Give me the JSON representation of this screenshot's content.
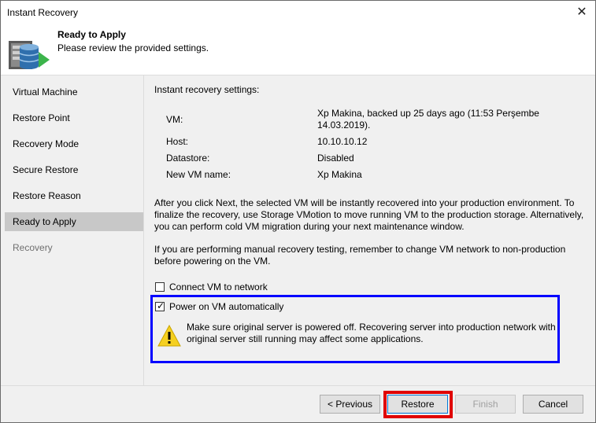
{
  "window": {
    "title": "Instant Recovery"
  },
  "header": {
    "title": "Ready to Apply",
    "subtitle": "Please review the provided  settings."
  },
  "sidebar": {
    "items": [
      {
        "label": "Virtual Machine"
      },
      {
        "label": "Restore Point"
      },
      {
        "label": "Recovery Mode"
      },
      {
        "label": "Secure Restore"
      },
      {
        "label": "Restore Reason"
      },
      {
        "label": "Ready to Apply"
      },
      {
        "label": "Recovery"
      }
    ]
  },
  "main": {
    "section_title": "Instant recovery settings:",
    "settings": [
      {
        "key": "VM:",
        "value_line1": "Xp Makina, backed up 25 days ago (11:53 Perşembe",
        "value_line2": "14.03.2019)."
      },
      {
        "key": "Host:",
        "value_line1": "10.10.10.12"
      },
      {
        "key": "Datastore:",
        "value_line1": "Disabled"
      },
      {
        "key": "New VM name:",
        "value_line1": "Xp Makina"
      }
    ],
    "info1": "After you click Next, the selected VM will be instantly recovered into your production environment. To finalize the recovery, use Storage VMotion to move running VM to the production storage. Alternatively, you can perform cold VM migration during your next maintenance window.",
    "info2": "If you are performing manual recovery testing, remember to change VM network to non-production before powering on the VM.",
    "connect_network": {
      "label": "Connect VM to network",
      "checked": false
    },
    "power_on": {
      "label": "Power on VM automatically",
      "checked": true
    },
    "warning": "Make sure original server is powered off. Recovering server into production network with original server still running may affect some applications."
  },
  "footer": {
    "previous": "< Previous",
    "restore": "Restore",
    "finish": "Finish",
    "cancel": "Cancel"
  },
  "colors": {
    "highlight_blue": "#0000ff",
    "highlight_red": "#e00000",
    "accent_green": "#3cb44b"
  }
}
